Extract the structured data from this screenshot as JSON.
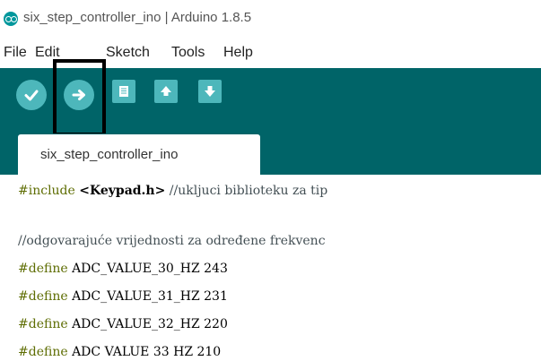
{
  "window": {
    "title": "six_step_controller_ino | Arduino 1.8.5",
    "icon": "arduino-logo"
  },
  "menubar": {
    "items": [
      "File",
      "Edit",
      "Sketch",
      "Tools",
      "Help"
    ]
  },
  "toolbar": {
    "buttons": [
      {
        "name": "verify",
        "icon": "checkmark-icon"
      },
      {
        "name": "upload",
        "icon": "arrow-right-icon"
      },
      {
        "name": "new",
        "icon": "new-file-icon"
      },
      {
        "name": "open",
        "icon": "open-arrow-up-icon"
      },
      {
        "name": "save",
        "icon": "save-arrow-down-icon"
      }
    ],
    "highlighted": "upload",
    "colors": {
      "bar": "#006468",
      "button": "#4db7bb",
      "glyph": "#ffffff"
    }
  },
  "tabs": [
    {
      "label": "six_step_controller_ino",
      "active": true
    }
  ],
  "editor": {
    "lines": [
      {
        "directive": "#include",
        "lib": "<Keypad.h>",
        "comment": " //ukljuci biblioteku za tip"
      },
      {
        "text": ""
      },
      {
        "comment": "//odgovarajuće vrijednosti za određene frekvenc"
      },
      {
        "directive": "#define",
        "text": " ADC_VALUE_30_HZ 243"
      },
      {
        "directive": "#define",
        "text": " ADC_VALUE_31_HZ 231"
      },
      {
        "directive": "#define",
        "text": " ADC_VALUE_32_HZ 220"
      },
      {
        "directive": "#define",
        "text": " ADC VALUE 33 HZ 210"
      }
    ]
  }
}
